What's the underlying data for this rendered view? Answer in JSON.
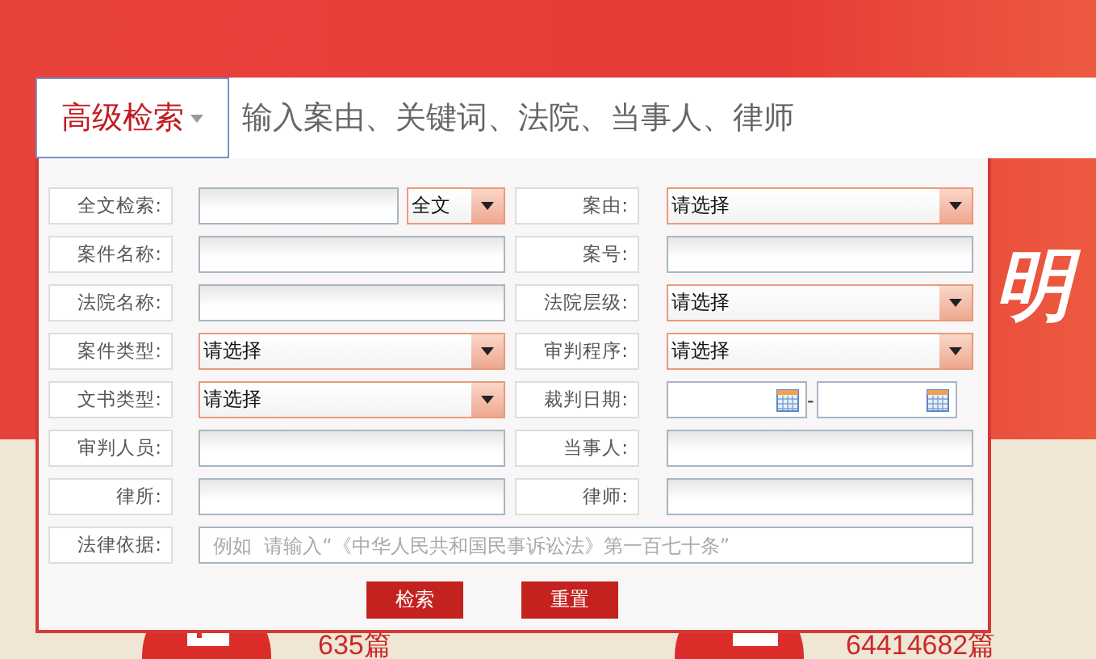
{
  "search_bar": {
    "mode_button": "高级检索",
    "placeholder": "输入案由、关键词、法院、当事人、律师"
  },
  "background": {
    "headline_fragment": "明",
    "stats": [
      "635篇",
      "64414682篇"
    ]
  },
  "form": {
    "rows": [
      {
        "fields": [
          {
            "label": "全文检索:",
            "kind": "fulltext",
            "value": "全文"
          },
          {
            "label": "案由:",
            "kind": "select",
            "value": "请选择"
          }
        ]
      },
      {
        "fields": [
          {
            "label": "案件名称:",
            "kind": "text"
          },
          {
            "label": "案号:",
            "kind": "text"
          }
        ]
      },
      {
        "fields": [
          {
            "label": "法院名称:",
            "kind": "text"
          },
          {
            "label": "法院层级:",
            "kind": "select",
            "value": "请选择"
          }
        ]
      },
      {
        "fields": [
          {
            "label": "案件类型:",
            "kind": "select",
            "value": "请选择"
          },
          {
            "label": "审判程序:",
            "kind": "select",
            "value": "请选择"
          }
        ]
      },
      {
        "fields": [
          {
            "label": "文书类型:",
            "kind": "select",
            "value": "请选择"
          },
          {
            "label": "裁判日期:",
            "kind": "daterange",
            "separator": "-"
          }
        ]
      },
      {
        "fields": [
          {
            "label": "审判人员:",
            "kind": "text"
          },
          {
            "label": "当事人:",
            "kind": "text"
          }
        ]
      },
      {
        "fields": [
          {
            "label": "律所:",
            "kind": "text"
          },
          {
            "label": "律师:",
            "kind": "text"
          }
        ]
      },
      {
        "fields": [
          {
            "label": "法律依据:",
            "kind": "wide",
            "placeholder": "例如  请输入“《中华人民共和国民事诉讼法》第一百七十条”"
          }
        ]
      }
    ],
    "buttons": [
      "检索",
      "重置"
    ]
  }
}
